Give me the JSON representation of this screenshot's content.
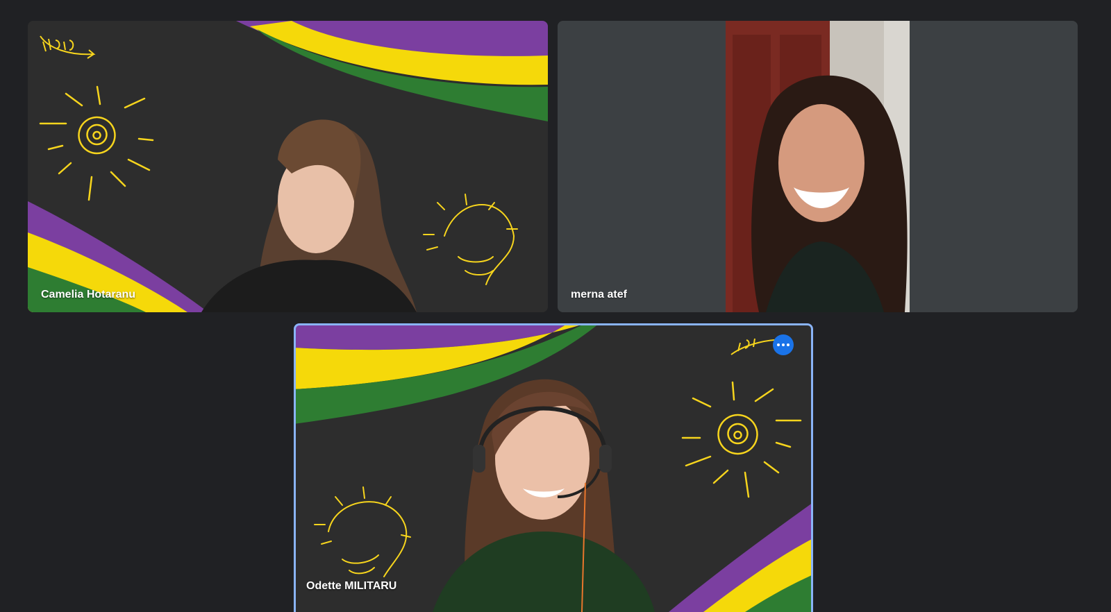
{
  "participants": [
    {
      "name": "Camelia Hotaranu"
    },
    {
      "name": "merna atef"
    },
    {
      "name": "Odette MILITARU"
    }
  ],
  "active_speaker_index": 2,
  "colors": {
    "page_bg": "#202124",
    "tile_bg": "#3c4043",
    "speaking_border": "#8ab4f8",
    "more_button": "#1a73e8",
    "band_purple": "#7b3fa0",
    "band_yellow": "#f5d90a",
    "band_green": "#2e7d32",
    "doodle_yellow": "#f7d51d"
  },
  "icons": {
    "more_options": "more-horiz-icon"
  }
}
